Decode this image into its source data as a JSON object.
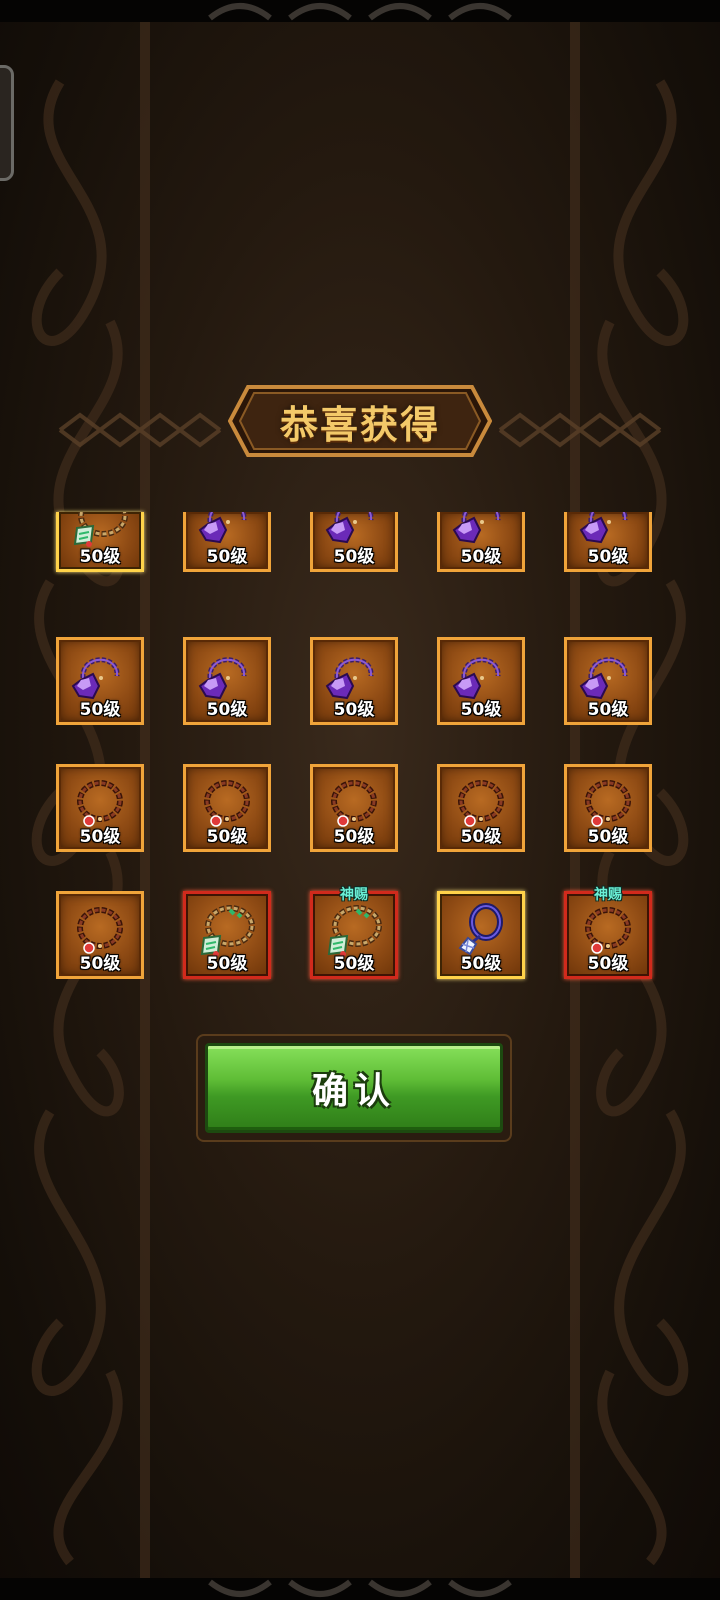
{
  "title": "恭喜获得",
  "confirm_label": "确认",
  "rows": [
    [
      {
        "level": "50级",
        "icon": "jade-bead-necklace-icon",
        "frame": "gold",
        "tag": ""
      },
      {
        "level": "50级",
        "icon": "purple-gem-necklace-icon",
        "frame": "orange",
        "tag": ""
      },
      {
        "level": "50级",
        "icon": "purple-gem-necklace-icon",
        "frame": "orange",
        "tag": ""
      },
      {
        "level": "50级",
        "icon": "purple-gem-necklace-icon",
        "frame": "orange",
        "tag": ""
      },
      {
        "level": "50级",
        "icon": "purple-gem-necklace-icon",
        "frame": "orange",
        "tag": ""
      }
    ],
    [
      {
        "level": "50级",
        "icon": "purple-gem-necklace-icon",
        "frame": "orange",
        "tag": ""
      },
      {
        "level": "50级",
        "icon": "purple-gem-necklace-icon",
        "frame": "orange",
        "tag": ""
      },
      {
        "level": "50级",
        "icon": "purple-gem-necklace-icon",
        "frame": "orange",
        "tag": ""
      },
      {
        "level": "50级",
        "icon": "purple-gem-necklace-icon",
        "frame": "orange",
        "tag": ""
      },
      {
        "level": "50级",
        "icon": "purple-gem-necklace-icon",
        "frame": "orange",
        "tag": ""
      }
    ],
    [
      {
        "level": "50级",
        "icon": "red-bead-bracelet-icon",
        "frame": "orange",
        "tag": ""
      },
      {
        "level": "50级",
        "icon": "red-bead-bracelet-icon",
        "frame": "orange",
        "tag": ""
      },
      {
        "level": "50级",
        "icon": "red-bead-bracelet-icon",
        "frame": "orange",
        "tag": ""
      },
      {
        "level": "50级",
        "icon": "red-bead-bracelet-icon",
        "frame": "orange",
        "tag": ""
      },
      {
        "level": "50级",
        "icon": "red-bead-bracelet-icon",
        "frame": "orange",
        "tag": ""
      }
    ],
    [
      {
        "level": "50级",
        "icon": "red-bead-bracelet-icon",
        "frame": "orange",
        "tag": ""
      },
      {
        "level": "50级",
        "icon": "jade-bead-necklace-icon",
        "frame": "red",
        "tag": ""
      },
      {
        "level": "50级",
        "icon": "jade-bead-necklace-icon",
        "frame": "red",
        "tag": "神赐"
      },
      {
        "level": "50级",
        "icon": "crystal-cord-pendant-icon",
        "frame": "gold",
        "tag": ""
      },
      {
        "level": "50级",
        "icon": "red-bead-bracelet-icon",
        "frame": "red",
        "tag": "神赐"
      }
    ]
  ],
  "colors": {
    "frame_orange": "#f0a43a",
    "frame_gold": "#ffd34a",
    "frame_red": "#d12a1c",
    "title_text": "#f3c969",
    "button_green": "#5fbd36",
    "tag_text": "#6af0d6"
  }
}
